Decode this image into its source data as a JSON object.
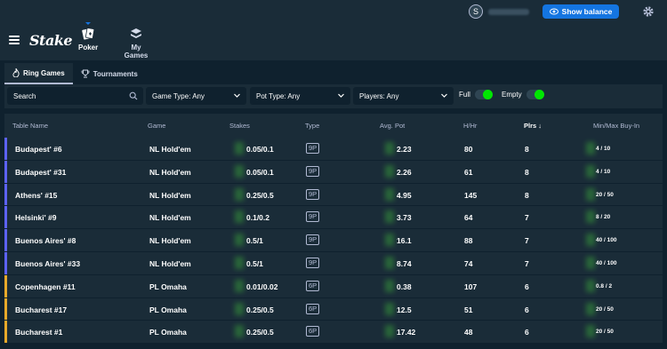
{
  "header": {
    "brand": "Stake",
    "nav": [
      {
        "label": "Poker",
        "icon": "poker-cards-icon"
      },
      {
        "label": "My Games",
        "icon": "chip-stack-icon"
      }
    ],
    "user_avatar_initial": "S",
    "show_balance_label": "Show balance"
  },
  "tabs": [
    {
      "label": "Ring Games",
      "icon": "flame-icon",
      "active": true
    },
    {
      "label": "Tournaments",
      "icon": "trophy-icon",
      "active": false
    }
  ],
  "filters": {
    "search_placeholder": "Search",
    "game_type": "Game Type: Any",
    "pot_type": "Pot Type: Any",
    "players": "Players: Any",
    "full_label": "Full",
    "full_on": true,
    "empty_label": "Empty",
    "empty_on": true
  },
  "table": {
    "columns": [
      "Table Name",
      "Game",
      "Stakes",
      "Type",
      "Avg. Pot",
      "H/Hr",
      "Plrs ↓",
      "Min/Max Buy-In"
    ],
    "rows": [
      {
        "name": "Budapest' #6",
        "game": "NL Hold'em",
        "stakes": "0.05/0.1",
        "type": "9P",
        "avg_pot": "2.23",
        "hhr": "80",
        "plrs": "8",
        "buyin": "4 / 10",
        "accent": "#5c62f6"
      },
      {
        "name": "Budapest' #31",
        "game": "NL Hold'em",
        "stakes": "0.05/0.1",
        "type": "9P",
        "avg_pot": "2.26",
        "hhr": "61",
        "plrs": "8",
        "buyin": "4 / 10",
        "accent": "#5c62f6"
      },
      {
        "name": "Athens' #15",
        "game": "NL Hold'em",
        "stakes": "0.25/0.5",
        "type": "9P",
        "avg_pot": "4.95",
        "hhr": "145",
        "plrs": "8",
        "buyin": "20 / 50",
        "accent": "#5c62f6"
      },
      {
        "name": "Helsinki' #9",
        "game": "NL Hold'em",
        "stakes": "0.1/0.2",
        "type": "9P",
        "avg_pot": "3.73",
        "hhr": "64",
        "plrs": "7",
        "buyin": "8 / 20",
        "accent": "#5c62f6"
      },
      {
        "name": "Buenos Aires' #8",
        "game": "NL Hold'em",
        "stakes": "0.5/1",
        "type": "9P",
        "avg_pot": "16.1",
        "hhr": "88",
        "plrs": "7",
        "buyin": "40 / 100",
        "accent": "#5c62f6"
      },
      {
        "name": "Buenos Aires' #33",
        "game": "NL Hold'em",
        "stakes": "0.5/1",
        "type": "9P",
        "avg_pot": "8.74",
        "hhr": "74",
        "plrs": "7",
        "buyin": "40 / 100",
        "accent": "#5c62f6"
      },
      {
        "name": "Copenhagen #11",
        "game": "PL Omaha",
        "stakes": "0.01/0.02",
        "type": "6P",
        "avg_pot": "0.38",
        "hhr": "107",
        "plrs": "6",
        "buyin": "0.8 / 2",
        "accent": "#e8a92a"
      },
      {
        "name": "Bucharest #17",
        "game": "PL Omaha",
        "stakes": "0.25/0.5",
        "type": "6P",
        "avg_pot": "12.5",
        "hhr": "51",
        "plrs": "6",
        "buyin": "20 / 50",
        "accent": "#e8a92a"
      },
      {
        "name": "Bucharest #1",
        "game": "PL Omaha",
        "stakes": "0.25/0.5",
        "type": "6P",
        "avg_pot": "17.42",
        "hhr": "48",
        "plrs": "6",
        "buyin": "20 / 50",
        "accent": "#e8a92a"
      }
    ]
  }
}
